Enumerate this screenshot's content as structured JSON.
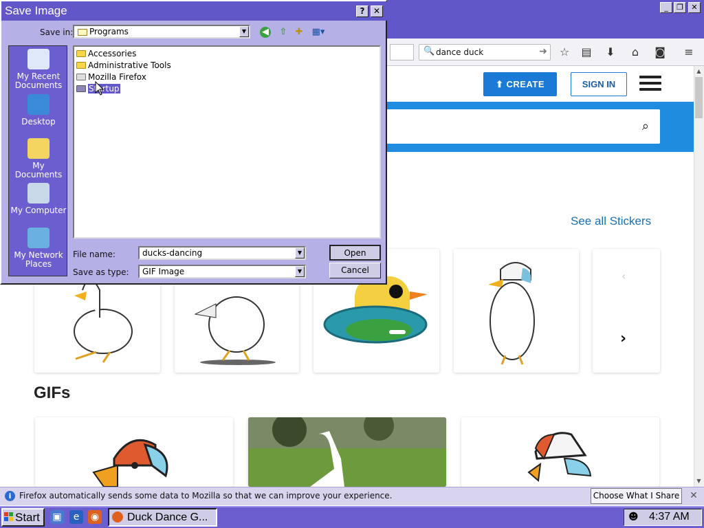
{
  "firefox": {
    "search_query": "dance duck",
    "create_label": "CREATE",
    "signin_label": "SIGN IN",
    "see_all_label": "See all Stickers",
    "gifs_heading": "GIFs"
  },
  "notification": {
    "message": "Firefox automatically sends some data to Mozilla so that we can improve your experience.",
    "choose_label": "Choose What I Share",
    "close_glyph": "✕"
  },
  "dialog": {
    "title": "Save Image",
    "help_glyph": "?",
    "close_glyph": "✕",
    "save_in_label": "Save in:",
    "save_in_value": "Programs",
    "places": [
      {
        "label": "My Recent Documents",
        "icon": "recent-documents-icon"
      },
      {
        "label": "Desktop",
        "icon": "desktop-icon"
      },
      {
        "label": "My Documents",
        "icon": "my-documents-icon"
      },
      {
        "label": "My Computer",
        "icon": "my-computer-icon"
      },
      {
        "label": "My Network Places",
        "icon": "network-places-icon"
      }
    ],
    "files": [
      {
        "name": "Accessories",
        "icon": "folder-icon"
      },
      {
        "name": "Administrative Tools",
        "icon": "folder-icon"
      },
      {
        "name": "Mozilla Firefox",
        "icon": "program-folder-icon"
      },
      {
        "name": "Startup",
        "icon": "folder-icon",
        "selected": true
      }
    ],
    "filename_label": "File name:",
    "filename_value": "ducks-dancing",
    "type_label": "Save as type:",
    "type_value": "GIF Image",
    "open_label": "Open",
    "cancel_label": "Cancel"
  },
  "taskbar": {
    "start_label": "Start",
    "task_label": "Duck Dance G...",
    "clock": "4:37 AM"
  },
  "colors": {
    "titlebar": "#6257c8",
    "dialog_bg": "#b5b0e6",
    "accent_blue": "#1f8ce0"
  }
}
